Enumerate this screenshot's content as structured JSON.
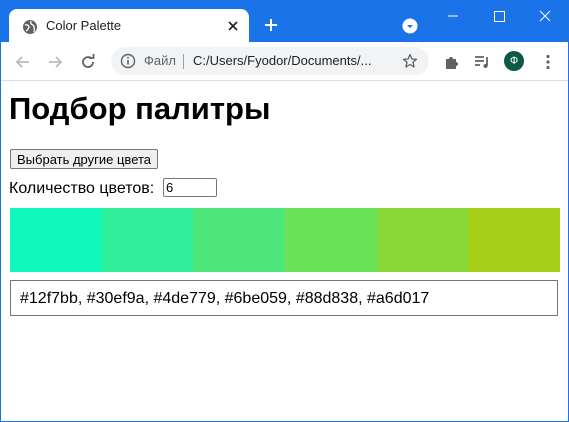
{
  "browser": {
    "tab": {
      "title": "Color Palette"
    },
    "omnibox": {
      "scheme": "Файл",
      "url": "C:/Users/Fyodor/Documents/..."
    },
    "profile": {
      "initial": "Ф",
      "color": "#0b5a47"
    },
    "accent_color": "#1a73e8"
  },
  "page": {
    "title": "Подбор палитры",
    "pick_button_label": "Выбрать другие цвета",
    "count_label": "Количество цветов:",
    "count_value": "6",
    "colors": [
      "#12f7bb",
      "#30ef9a",
      "#4de779",
      "#6be059",
      "#88d838",
      "#a6d017"
    ],
    "hex_list": "#12f7bb, #30ef9a, #4de779, #6be059, #88d838, #a6d017"
  }
}
